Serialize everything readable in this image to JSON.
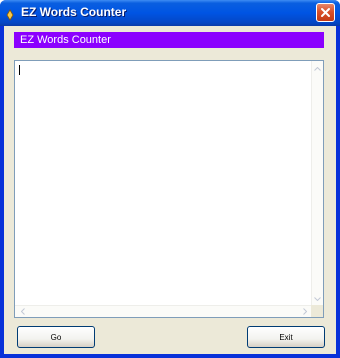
{
  "window": {
    "title": "EZ Words Counter"
  },
  "header": {
    "label": "EZ Words Counter",
    "background": "#8b00ff"
  },
  "editor": {
    "value": ""
  },
  "buttons": {
    "go_label": "Go",
    "exit_label": "Exit"
  },
  "colors": {
    "titlebar": "#0054e3",
    "window_body": "#ece9d8",
    "close_button": "#d9512b"
  },
  "icons": {
    "app": "app-icon",
    "close": "close-icon",
    "scroll_up": "chevron-up-icon",
    "scroll_down": "chevron-down-icon",
    "scroll_left": "chevron-left-icon",
    "scroll_right": "chevron-right-icon"
  }
}
